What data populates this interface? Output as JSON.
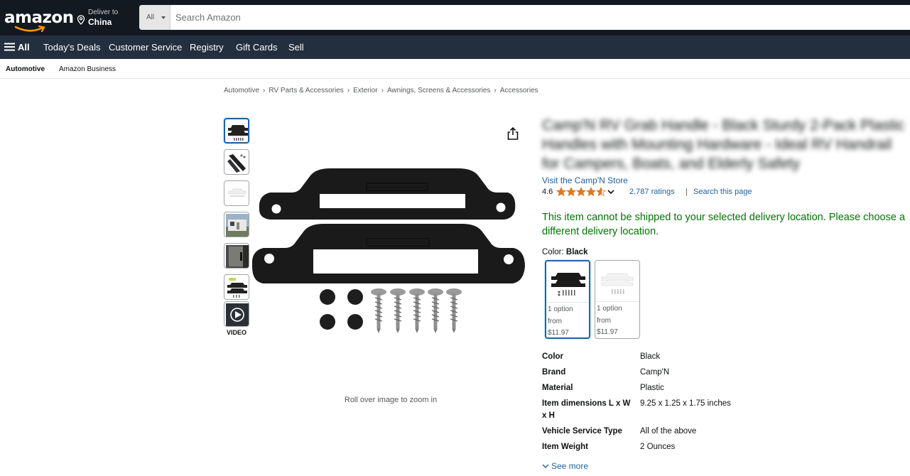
{
  "header": {
    "logo_text": "amazon",
    "deliver_to_label": "Deliver to",
    "deliver_to_location": "China",
    "search_category": "All",
    "search_placeholder": "Search Amazon"
  },
  "nav": {
    "all_label": "All",
    "items": [
      "Today's Deals",
      "Customer Service",
      "Registry",
      "Gift Cards",
      "Sell"
    ]
  },
  "subnav": {
    "items": [
      "Automotive",
      "Amazon Business"
    ]
  },
  "breadcrumb": [
    "Automotive",
    "RV Parts & Accessories",
    "Exterior",
    "Awnings, Screens & Accessories",
    "Accessories"
  ],
  "gallery": {
    "video_label": "VIDEO",
    "zoom_hint": "Roll over image to zoom in"
  },
  "product": {
    "title_blurred": "Camp'N RV Grab Handle - Black Sturdy 2-Pack Plastic Handles with Mounting Hardware - Ideal RV Handrail for Campers, Boats, and Elderly Safety",
    "store_link": "Visit the Camp'N Store",
    "rating_value": "4.6",
    "rating_stars": 4.6,
    "ratings_count": "2,787 ratings",
    "rating_separator": "|",
    "search_page_link": "Search this page",
    "shipping_warning": "This item cannot be shipped to your selected delivery location. Please choose a different delivery location.",
    "color_label": "Color:",
    "color_selected": "Black",
    "swatches": [
      {
        "line1": "1 option",
        "line2": "from",
        "price": "$11.97"
      },
      {
        "line1": "1 option",
        "line2": "from",
        "price": "$11.97"
      }
    ],
    "specs": [
      {
        "key": "Color",
        "value": "Black"
      },
      {
        "key": "Brand",
        "value": "Camp'N"
      },
      {
        "key": "Material",
        "value": "Plastic"
      },
      {
        "key": "Item dimensions L x W x H",
        "value": "9.25 x 1.25 x 1.75 inches"
      },
      {
        "key": "Vehicle Service Type",
        "value": "All of the above"
      },
      {
        "key": "Item Weight",
        "value": "2 Ounces"
      }
    ],
    "see_more": "See more"
  },
  "colors": {
    "topbar": "#131921",
    "navbar": "#232f3e",
    "link": "#2162a1",
    "warning": "#007600",
    "star": "#de7921"
  }
}
